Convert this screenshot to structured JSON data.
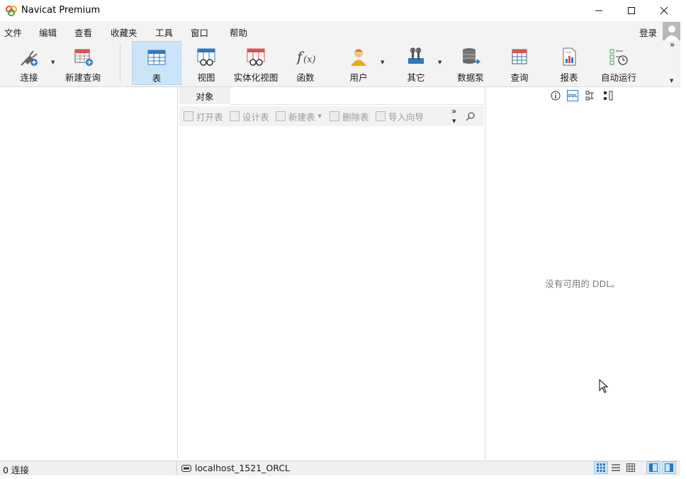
{
  "app": {
    "title": "Navicat Premium"
  },
  "menu": [
    "文件",
    "编辑",
    "查看",
    "收藏夹",
    "工具",
    "窗口",
    "帮助"
  ],
  "login_label": "登录",
  "toolbar": {
    "items": [
      {
        "label": "连接",
        "icon": "plug-connection-icon"
      },
      {
        "label": "新建查询",
        "icon": "new-query-icon"
      },
      {
        "label": "表",
        "icon": "table-icon",
        "active": true
      },
      {
        "label": "视图",
        "icon": "view-icon"
      },
      {
        "label": "实体化视图",
        "icon": "materialized-view-icon"
      },
      {
        "label": "函数",
        "icon": "function-icon"
      },
      {
        "label": "用户",
        "icon": "user-icon"
      },
      {
        "label": "其它",
        "icon": "tools-icon"
      },
      {
        "label": "数据泵",
        "icon": "datapump-icon"
      },
      {
        "label": "查询",
        "icon": "query-icon"
      },
      {
        "label": "报表",
        "icon": "report-icon"
      },
      {
        "label": "自动运行",
        "icon": "automation-icon"
      }
    ],
    "overflow": "»"
  },
  "object_tab": {
    "label": "对象"
  },
  "object_toolbar": {
    "open_table": "打开表",
    "design_table": "设计表",
    "new_table": "新建表",
    "delete_table": "删除表",
    "import_wizard": "导入向导",
    "more": "»"
  },
  "ddl_panel": {
    "empty_text": "没有可用的 DDL。",
    "ddl_tab": "DDL"
  },
  "status": {
    "connections": "0 连接",
    "current_connection": "localhost_1521_ORCL"
  },
  "colors": {
    "accent": "#2b78c5",
    "toolbar_bg": "#f3f3f3",
    "active_tab": "#cce4f7"
  }
}
